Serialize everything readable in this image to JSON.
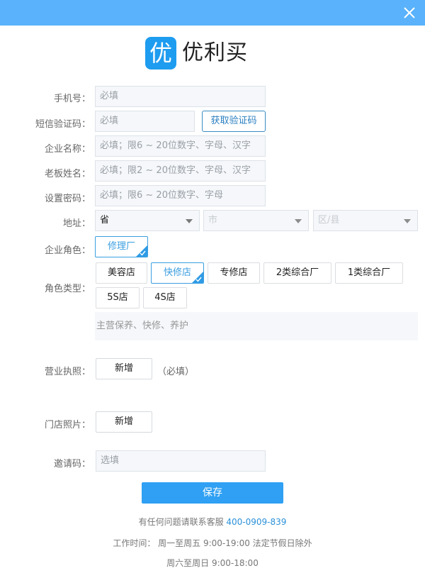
{
  "window": {
    "close_icon": "close-icon",
    "accent_color": "#59b2fb"
  },
  "logo": {
    "mark": "优",
    "text": "优利买"
  },
  "form": {
    "phone": {
      "label": "手机号：",
      "placeholder": "必填"
    },
    "sms_code": {
      "label": "短信验证码：",
      "placeholder": "必填",
      "button": "获取验证码"
    },
    "company_name": {
      "label": "企业名称：",
      "placeholder": "必填；限6 ~ 20位数字、字母、汉字"
    },
    "owner_name": {
      "label": "老板姓名：",
      "placeholder": "必填；限2 ~ 20位数字、字母、汉字"
    },
    "password": {
      "label": "设置密码：",
      "placeholder": "必填；限6 ~ 20位数字、字母"
    },
    "address": {
      "label": "地址：",
      "province": "省",
      "city": "市",
      "district": "区/县"
    },
    "company_role": {
      "label": "企业角色：",
      "options": [
        {
          "label": "修理厂",
          "selected": true
        }
      ]
    },
    "role_type": {
      "label": "角色类型：",
      "options": [
        {
          "label": "美容店",
          "selected": false
        },
        {
          "label": "快修店",
          "selected": true
        },
        {
          "label": "专修店",
          "selected": false
        },
        {
          "label": "2类综合厂",
          "selected": false
        },
        {
          "label": "1类综合厂",
          "selected": false
        },
        {
          "label": "5S店",
          "selected": false
        },
        {
          "label": "4S店",
          "selected": false
        }
      ],
      "description": "主营保养、快修、养护"
    },
    "business_license": {
      "label": "营业执照：",
      "button": "新增",
      "note": "（必填）"
    },
    "store_photo": {
      "label": "门店照片：",
      "button": "新增"
    },
    "invite_code": {
      "label": "邀请码：",
      "placeholder": "选填"
    }
  },
  "save_button": "保存",
  "footer": {
    "contact_text": "有任何问题请联系客服",
    "phone": "400-0909-839",
    "hours_weekday": "工作时间： 周一至周五 9:00-19:00 法定节假日除外",
    "hours_weekend": "周六至周日 9:00-18:00"
  }
}
